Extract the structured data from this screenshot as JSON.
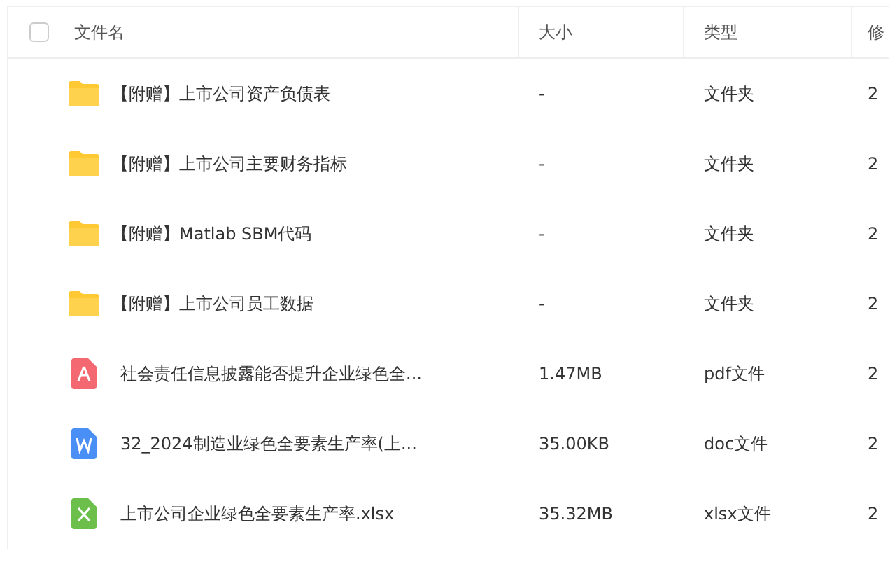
{
  "table": {
    "select_all": {
      "checked": false
    },
    "columns": [
      "文件名",
      "大小",
      "类型",
      "修"
    ],
    "rows": [
      {
        "kind": "folder",
        "name": "【附赠】上市公司资产负债表",
        "size": "-",
        "type": "文件夹",
        "column_4": "2"
      },
      {
        "kind": "folder",
        "name": "【附赠】上市公司主要财务指标",
        "size": "-",
        "type": "文件夹",
        "column_4": "2"
      },
      {
        "kind": "folder",
        "name": "【附赠】Matlab SBM代码",
        "size": "-",
        "type": "文件夹",
        "column_4": "2"
      },
      {
        "kind": "folder",
        "name": "【附赠】上市公司员工数据",
        "size": "-",
        "type": "文件夹",
        "column_4": "2"
      },
      {
        "kind": "pdf",
        "name": "社会责任信息披露能否提升企业绿色全...",
        "size": "1.47MB",
        "type": "pdf文件",
        "column_4": "2"
      },
      {
        "kind": "doc",
        "name": "32_2024制造业绿色全要素生产率(上...",
        "size": "35.00KB",
        "type": "doc文件",
        "column_4": "2"
      },
      {
        "kind": "xlsx",
        "name": "上市公司企业绿色全要素生产率.xlsx",
        "size": "35.32MB",
        "type": "xlsx文件",
        "column_4": "2"
      }
    ]
  }
}
